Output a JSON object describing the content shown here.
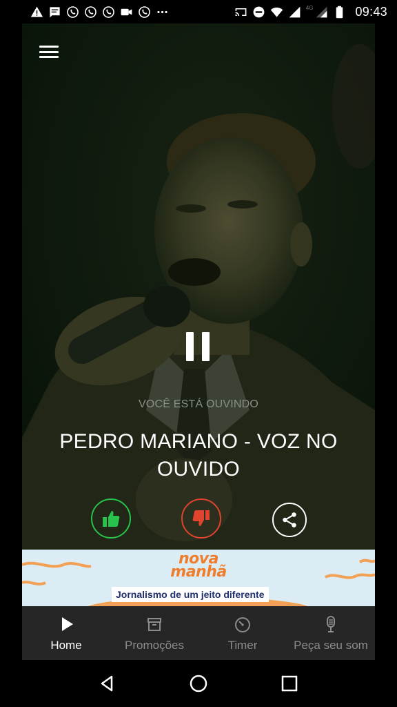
{
  "status_bar": {
    "time": "09:43",
    "network_label": "4G",
    "icons": [
      "warning-icon",
      "message-icon",
      "whatsapp-icon",
      "whatsapp-icon",
      "whatsapp-icon",
      "video-icon",
      "whatsapp-icon",
      "more-icon",
      "cast-icon",
      "do-not-disturb-icon",
      "wifi-icon",
      "signal-icon",
      "signal-icon",
      "battery-icon"
    ]
  },
  "player": {
    "menu_icon": "hamburger-icon",
    "state": "playing",
    "pause_icon": "pause-icon",
    "listening_label": "VOCÊ ESTÁ OUVINDO",
    "track_title": "PEDRO MARIANO - VOZ NO OUVIDO",
    "actions": [
      {
        "name": "like",
        "icon": "thumbs-up-icon",
        "color": "#27c24c"
      },
      {
        "name": "dislike",
        "icon": "thumbs-down-icon",
        "color": "#e0432e"
      },
      {
        "name": "share",
        "icon": "share-icon",
        "color": "#ffffff"
      }
    ]
  },
  "banner": {
    "logo_line1": "nova",
    "logo_line2": "manhã",
    "tagline": "Jornalismo de um jeito diferente",
    "logo_color": "#ef7d2e",
    "background": "#dcecf4"
  },
  "bottom_nav": {
    "items": [
      {
        "label": "Home",
        "icon": "play-icon",
        "active": true
      },
      {
        "label": "Promoções",
        "icon": "archive-icon",
        "active": false
      },
      {
        "label": "Timer",
        "icon": "timer-icon",
        "active": false
      },
      {
        "label": "Peça seu som",
        "icon": "microphone-icon",
        "active": false
      }
    ]
  },
  "system_nav": {
    "buttons": [
      "back-icon",
      "home-icon",
      "recents-icon"
    ]
  }
}
